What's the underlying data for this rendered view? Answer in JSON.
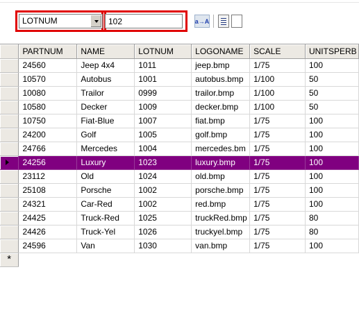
{
  "toolbar": {
    "field_select_value": "LOTNUM",
    "search_value": "102",
    "sort_button_label": "a→A",
    "list_view_icon": "list-view-icon",
    "blank_view_icon": "blank-page-icon"
  },
  "grid": {
    "columns": [
      "PARTNUM",
      "NAME",
      "LOTNUM",
      "LOGONAME",
      "SCALE",
      "UNITSPERB"
    ],
    "rows": [
      [
        "24560",
        "Jeep 4x4",
        "1011",
        "jeep.bmp",
        "1/75",
        "100"
      ],
      [
        "10570",
        "Autobus",
        "1001",
        "autobus.bmp",
        "1/100",
        "50"
      ],
      [
        "10080",
        "Trailor",
        "0999",
        "trailor.bmp",
        "1/100",
        "50"
      ],
      [
        "10580",
        "Decker",
        "1009",
        "decker.bmp",
        "1/100",
        "50"
      ],
      [
        "10750",
        "Fiat-Blue",
        "1007",
        "fiat.bmp",
        "1/75",
        "100"
      ],
      [
        "24200",
        "Golf",
        "1005",
        "golf.bmp",
        "1/75",
        "100"
      ],
      [
        "24766",
        "Mercedes",
        "1004",
        "mercedes.bm",
        "1/75",
        "100"
      ],
      [
        "24256",
        "Luxury",
        "1023",
        "luxury.bmp",
        "1/75",
        "100"
      ],
      [
        "23112",
        "Old",
        "1024",
        "old.bmp",
        "1/75",
        "100"
      ],
      [
        "25108",
        "Porsche",
        "1002",
        "porsche.bmp",
        "1/75",
        "100"
      ],
      [
        "24321",
        "Car-Red",
        "1002",
        "red.bmp",
        "1/75",
        "100"
      ],
      [
        "24425",
        "Truck-Red",
        "1025",
        "truckRed.bmp",
        "1/75",
        "80"
      ],
      [
        "24426",
        "Truck-Yel",
        "1026",
        "truckyel.bmp",
        "1/75",
        "80"
      ],
      [
        "24596",
        "Van",
        "1030",
        "van.bmp",
        "1/75",
        "100"
      ]
    ],
    "selected_row": 7,
    "new_row_marker": "*",
    "selection_color": "#800080",
    "highlight_color": "#e00000"
  }
}
